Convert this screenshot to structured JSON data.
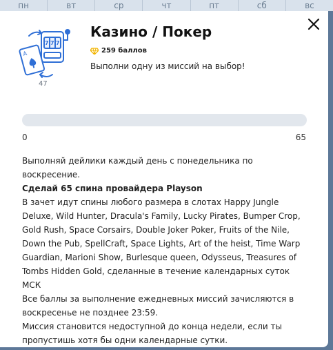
{
  "weekdays": [
    "пн",
    "вт",
    "ср",
    "чт",
    "пт",
    "сб",
    "вс"
  ],
  "modal": {
    "title": "Казино / Покер",
    "points": "259 баллов",
    "subtitle": "Выполни одну из миссий на выбор!",
    "count": "47",
    "progress": {
      "value": 0,
      "min_label": "0",
      "max_label": "65"
    },
    "paragraphs": [
      "Выполняй дейлики каждый день с понедельника по воскресение.",
      "Сделай 65 спина провайдера Playson",
      "В зачет идут спины любого размера в слотах Happy Jungle Deluxe, Wild Hunter, Dracula's Family, Lucky Pirates, Bumper Crop, Gold Rush, Space Corsairs, Double Joker Poker, Fruits of the Nile, Down the Pub, SpellCraft, Space Lights, Art of the heist, Time Warp Guardian, Marioni Show, Burlesque queen, Odysseus, Treasures of Tombs Hidden Gold, сделанные в течение календарных суток МСК",
      "Все баллы за выполнение ежедневных миссий зачисляются в воскресенье не позднее 23:59.",
      "Миссия становится недоступной до конца недели, если ты пропустишь хотя бы одни календарные сутки."
    ]
  },
  "colors": {
    "accent_illustration": "#2f6fd6",
    "gem": "#f2b400",
    "progress_track": "#e2e7ed"
  },
  "icons": {
    "close": "close-icon",
    "points": "gem-icon",
    "illustration": "slot-machine-cards-icon"
  }
}
